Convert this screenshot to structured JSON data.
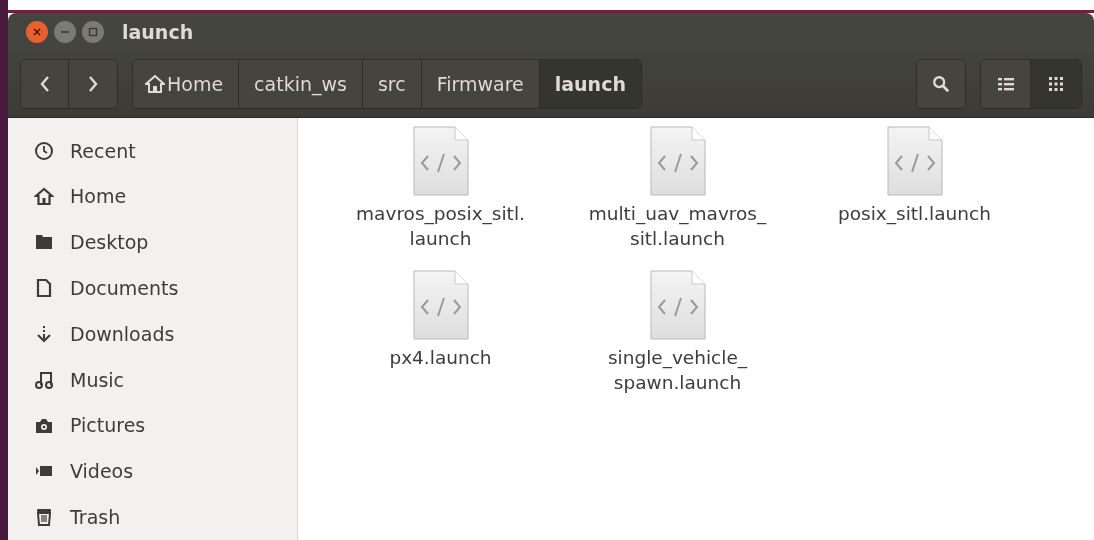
{
  "window": {
    "title": "launch"
  },
  "path_bar": [
    {
      "label": "Home",
      "kind": "home",
      "selected": false
    },
    {
      "label": "catkin_ws",
      "kind": "folder",
      "selected": false
    },
    {
      "label": "src",
      "kind": "folder",
      "selected": false
    },
    {
      "label": "Firmware",
      "kind": "folder",
      "selected": false
    },
    {
      "label": "launch",
      "kind": "folder",
      "selected": true
    }
  ],
  "view_buttons": [
    {
      "kind": "list",
      "selected": false
    },
    {
      "kind": "grid",
      "selected": true
    }
  ],
  "sidebar": {
    "items": [
      {
        "label": "Recent",
        "kind": "recent"
      },
      {
        "label": "Home",
        "kind": "home"
      },
      {
        "label": "Desktop",
        "kind": "desktop"
      },
      {
        "label": "Documents",
        "kind": "documents"
      },
      {
        "label": "Downloads",
        "kind": "downloads"
      },
      {
        "label": "Music",
        "kind": "music"
      },
      {
        "label": "Pictures",
        "kind": "pictures"
      },
      {
        "label": "Videos",
        "kind": "videos"
      },
      {
        "label": "Trash",
        "kind": "trash"
      }
    ]
  },
  "files": [
    {
      "name_lines": [
        "mavros_posix_sitl.",
        "launch"
      ]
    },
    {
      "name_lines": [
        "multi_uav_mavros_",
        "sitl.launch"
      ]
    },
    {
      "name_lines": [
        "posix_sitl.launch"
      ]
    },
    {
      "name_lines": [
        "px4.launch"
      ]
    },
    {
      "name_lines": [
        "single_vehicle_",
        "spawn.launch"
      ]
    }
  ]
}
